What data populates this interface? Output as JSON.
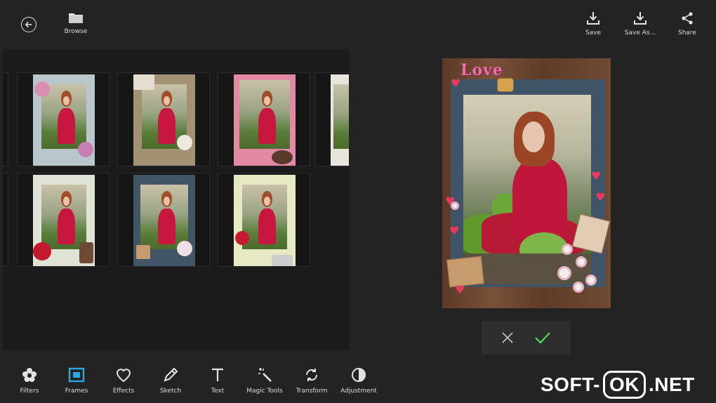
{
  "header": {
    "browse_label": "Browse",
    "save_label": "Save",
    "save_as_label": "Save As...",
    "share_label": "Share"
  },
  "icons": {
    "back": "arrow-left-circle-icon",
    "browse": "folder-icon",
    "save": "download-icon",
    "save_as": "download-icon",
    "share": "share-icon",
    "cancel": "close-icon",
    "apply": "check-icon"
  },
  "gallery": {
    "rows": 2,
    "visible_frames": 8
  },
  "preview": {
    "frame_text": "Love"
  },
  "toolbar": {
    "items": [
      {
        "label": "Filters",
        "icon": "flower-icon"
      },
      {
        "label": "Frames",
        "icon": "frame-icon",
        "active": true
      },
      {
        "label": "Effects",
        "icon": "heart-icon"
      },
      {
        "label": "Sketch",
        "icon": "pencil-icon"
      },
      {
        "label": "Text",
        "icon": "text-icon"
      },
      {
        "label": "Magic Tools",
        "icon": "magic-wand-icon"
      },
      {
        "label": "Transform",
        "icon": "rotate-icon"
      },
      {
        "label": "Adjustment",
        "icon": "contrast-icon"
      }
    ]
  },
  "watermark": {
    "left": "SOFT-",
    "middle": "OK",
    "right": ".NET"
  },
  "colors": {
    "background": "#232323",
    "panel": "#1b1b1b",
    "accent": "#2aa9e0",
    "confirm_check": "#4cd964"
  }
}
